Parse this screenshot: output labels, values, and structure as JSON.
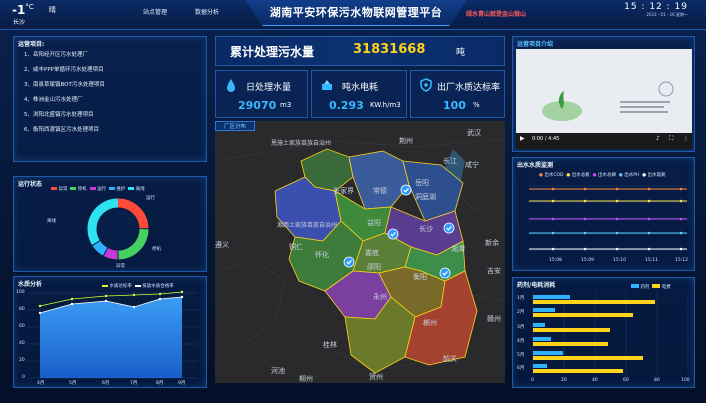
{
  "header": {
    "temp": "-1",
    "temp_unit": "°C",
    "location": "长沙",
    "condition": "晴",
    "nav_left": "站点管理",
    "nav_right": "数据分析",
    "title": "湖南平安环保污水物联网管理平台",
    "slogan": "绿水青山就是金山银山",
    "time": "15 : 12 : 19",
    "date": "2023 - 01 - 16   星期一"
  },
  "projects": {
    "title": "运营项目:",
    "items": [
      "1、岳阳经开区污水处理厂",
      "2、咸丰PPP单循环污水处理项目",
      "3、南县草尾镇BOT污水处理项目",
      "4、株洲金山污水处理厂",
      "5、浏阳北盛镇污水处理项目",
      "6、衡阳西渡镇区污水处理项目"
    ]
  },
  "status": {
    "title": "运行状态",
    "legend": [
      "异常",
      "停机",
      "运行",
      "维护",
      "离线"
    ],
    "legend_colors": [
      "#ff4a3a",
      "#45d060",
      "#c83ad8",
      "#2fb3ff",
      "#2fe2f2"
    ],
    "labels": [
      "运行",
      "停机",
      "异常",
      "维护",
      "离线"
    ]
  },
  "water": {
    "title": "水质分析",
    "legend": [
      "水质达标率",
      "排放水质合格率"
    ],
    "ticks_y": [
      "100",
      "80",
      "60",
      "40",
      "20",
      "0"
    ],
    "ticks_x": [
      "4月",
      "5月",
      "6月",
      "7月",
      "8月",
      "9月"
    ]
  },
  "center": {
    "total_label": "累计处理污水量",
    "total_value": "31831668",
    "total_unit": "吨",
    "kpis": [
      {
        "label": "日处理水量",
        "value": "29070",
        "unit": "m3"
      },
      {
        "label": "吨水电耗",
        "value": "0.293",
        "unit": "KW.h/m3"
      },
      {
        "label": "出厂水质达标率",
        "value": "100",
        "unit": "%"
      }
    ],
    "map_tab": "厂区分布"
  },
  "map": {
    "labels": [
      {
        "t": "恩施土家族苗族自治州",
        "c": "#bfc7d6"
      },
      {
        "t": "荆州",
        "c": "#bfc7d6"
      },
      {
        "t": "武汉",
        "c": "#bfc7d6"
      },
      {
        "t": "咸宁",
        "c": "#bfc7d6"
      },
      {
        "t": "长江",
        "c": "#bfc7d6"
      },
      {
        "t": "张家界",
        "c": "#cfd8e6"
      },
      {
        "t": "常德",
        "c": "#cfd8e6"
      },
      {
        "t": "岳阳",
        "c": "#cfd8e6"
      },
      {
        "t": "洞庭湖",
        "c": "#cfd8e6"
      },
      {
        "t": "湘西土家族苗族自治州",
        "c": "#cfd8e6"
      },
      {
        "t": "益阳",
        "c": "#cfd8e6"
      },
      {
        "t": "长沙",
        "c": "#cfd8e6"
      },
      {
        "t": "铜仁",
        "c": "#bfc7d6"
      },
      {
        "t": "遵义",
        "c": "#bfc7d6"
      },
      {
        "t": "怀化",
        "c": "#cfd8e6"
      },
      {
        "t": "娄底",
        "c": "#cfd8e6"
      },
      {
        "t": "湘潭",
        "c": "#cfd8e6"
      },
      {
        "t": "新余",
        "c": "#bfc7d6"
      },
      {
        "t": "邵阳",
        "c": "#cfd8e6"
      },
      {
        "t": "衡阳",
        "c": "#cfd8e6"
      },
      {
        "t": "吉安",
        "c": "#bfc7d6"
      },
      {
        "t": "永州",
        "c": "#cfd8e6"
      },
      {
        "t": "郴州",
        "c": "#cfd8e6"
      },
      {
        "t": "赣州",
        "c": "#bfc7d6"
      },
      {
        "t": "桂林",
        "c": "#bfc7d6"
      },
      {
        "t": "韶关",
        "c": "#bfc7d6"
      },
      {
        "t": "河池",
        "c": "#bfc7d6"
      },
      {
        "t": "柳州",
        "c": "#bfc7d6"
      },
      {
        "t": "贺州",
        "c": "#bfc7d6"
      }
    ]
  },
  "video": {
    "title": "运营项目介绍",
    "time": "0:00 / 4:45"
  },
  "monitor": {
    "title": "出水水质监测",
    "legend": [
      "出水COD",
      "出水总氮",
      "出水总磷",
      "出水PH",
      "出水氨氮"
    ],
    "colors": [
      "#ff8a3a",
      "#ffe14a",
      "#c94dff",
      "#5ad0ff",
      "#ffffff"
    ],
    "ticks_x": [
      "15:08",
      "15:09",
      "15:10",
      "15:11",
      "15:12"
    ]
  },
  "energy": {
    "title": "药剂/电耗消耗",
    "legend": [
      "药剂",
      "电费"
    ],
    "colors": [
      "#2fb3ff",
      "#ffd319"
    ],
    "cats": [
      "1月",
      "2月",
      "3月",
      "4月",
      "5月",
      "6月"
    ],
    "ticks_x": [
      "0",
      "20",
      "40",
      "60",
      "80",
      "100"
    ]
  }
}
